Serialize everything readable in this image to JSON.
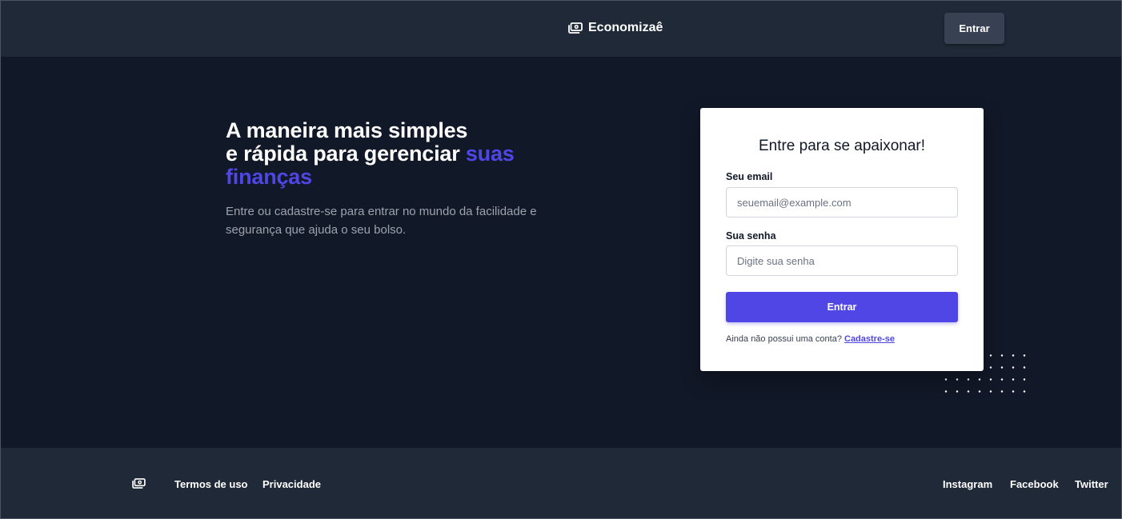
{
  "header": {
    "brand_name": "Economizaê",
    "brand_icon": "money-bill-icon",
    "login_button": "Entrar"
  },
  "hero": {
    "title_line1": "A maneira mais simples",
    "title_line2": "e rápida para gerenciar ",
    "title_accent": "suas finanças",
    "subtitle": "Entre ou cadastre-se para entrar no mundo da facilidade e segurança que ajuda o seu bolso."
  },
  "login_form": {
    "title": "Entre para se apaixonar!",
    "email_label": "Seu email",
    "email_placeholder": "seuemail@example.com",
    "email_value": "",
    "password_label": "Sua senha",
    "password_placeholder": "Digite sua senha",
    "password_value": "",
    "submit_label": "Entrar",
    "signup_prompt": "Ainda não possui uma conta?",
    "signup_link": "Cadastre-se"
  },
  "footer": {
    "logo_icon": "money-bill-icon",
    "links_left": [
      "Termos de uso",
      "Privacidade"
    ],
    "links_right": [
      "Instagram",
      "Facebook",
      "Twitter"
    ]
  },
  "colors": {
    "accent": "#4f46e5",
    "header_bg": "#1f2937",
    "page_bg": "#111827",
    "button_dark": "#374151"
  }
}
